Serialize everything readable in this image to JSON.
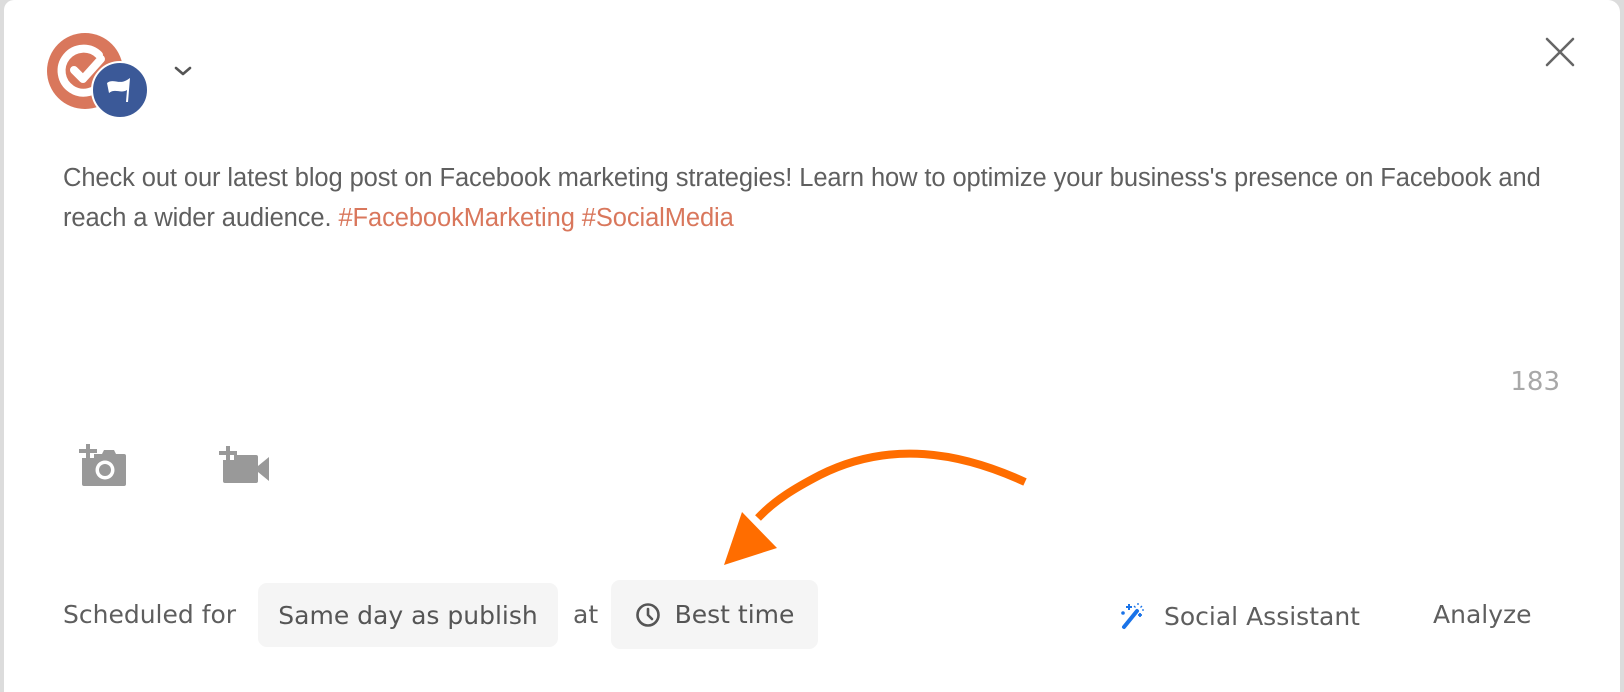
{
  "account": {
    "icon": "account-avatar",
    "badge_icon": "flag-icon",
    "dropdown_icon": "chevron-down-icon",
    "avatar_color": "#d9775c",
    "badge_color": "#3b5998"
  },
  "header": {
    "close_icon": "close-icon"
  },
  "post": {
    "text": "Check out our latest blog post on Facebook marketing strategies! Learn how to optimize your business's presence on Facebook and reach a wider audience.",
    "hashtags": [
      "#FacebookMarketing",
      "#SocialMedia"
    ],
    "hashtag_color": "#d9775c",
    "char_count": "183"
  },
  "media": {
    "add_photo_icon": "add-photo-icon",
    "add_video_icon": "add-video-icon"
  },
  "annotation": {
    "arrow_color": "#ff6d00",
    "arrow_icon": "curved-arrow-annotation"
  },
  "schedule": {
    "label": "Scheduled for",
    "day_value": "Same day as publish",
    "at_label": "at",
    "time_icon": "clock-icon",
    "time_value": "Best time"
  },
  "actions": {
    "assistant_icon": "magic-wand-icon",
    "assistant_label": "Social Assistant",
    "assistant_color": "#1a73e8",
    "analyze_label": "Analyze"
  }
}
